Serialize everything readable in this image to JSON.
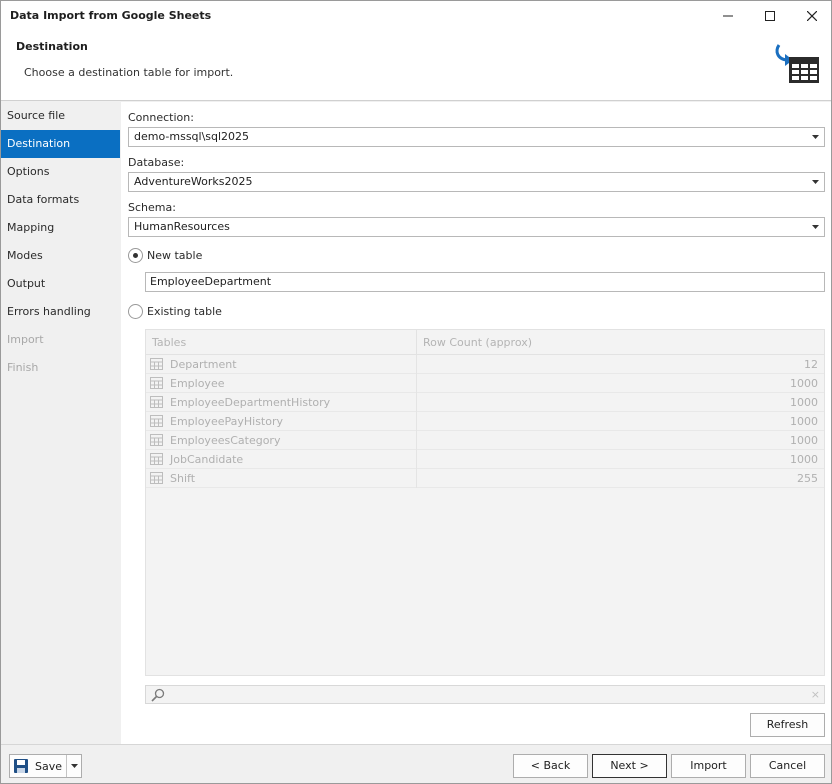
{
  "window": {
    "title": "Data Import from Google Sheets"
  },
  "header": {
    "title": "Destination",
    "description": "Choose a destination table for import.",
    "icon": "import-table-icon"
  },
  "sidebar": {
    "items": [
      {
        "label": "Source file",
        "state": "normal"
      },
      {
        "label": "Destination",
        "state": "active"
      },
      {
        "label": "Options",
        "state": "normal"
      },
      {
        "label": "Data formats",
        "state": "normal"
      },
      {
        "label": "Mapping",
        "state": "normal"
      },
      {
        "label": "Modes",
        "state": "normal"
      },
      {
        "label": "Output",
        "state": "normal"
      },
      {
        "label": "Errors handling",
        "state": "normal"
      },
      {
        "label": "Import",
        "state": "disabled"
      },
      {
        "label": "Finish",
        "state": "disabled"
      }
    ]
  },
  "form": {
    "connection_label": "Connection:",
    "connection_value": "demo-mssql\\sql2025",
    "database_label": "Database:",
    "database_value": "AdventureWorks2025",
    "schema_label": "Schema:",
    "schema_value": "HumanResources",
    "new_table_label": "New table",
    "new_table_selected": true,
    "new_table_name": "EmployeeDepartment",
    "existing_table_label": "Existing table",
    "existing_table_selected": false
  },
  "tables_grid": {
    "columns": [
      "Tables",
      "Row Count (approx)"
    ],
    "rows": [
      {
        "name": "Department",
        "count": "12"
      },
      {
        "name": "Employee",
        "count": "1000"
      },
      {
        "name": "EmployeeDepartmentHistory",
        "count": "1000"
      },
      {
        "name": "EmployeePayHistory",
        "count": "1000"
      },
      {
        "name": "EmployeesCategory",
        "count": "1000"
      },
      {
        "name": "JobCandidate",
        "count": "1000"
      },
      {
        "name": "Shift",
        "count": "255"
      }
    ],
    "search_clear": "×"
  },
  "buttons": {
    "refresh": "Refresh",
    "save": "Save",
    "back": "< Back",
    "next": "Next >",
    "import": "Import",
    "cancel": "Cancel"
  },
  "colors": {
    "accent": "#0a6fc2",
    "icon_dark": "#2b2b2b",
    "icon_blue": "#1a6fc0"
  }
}
